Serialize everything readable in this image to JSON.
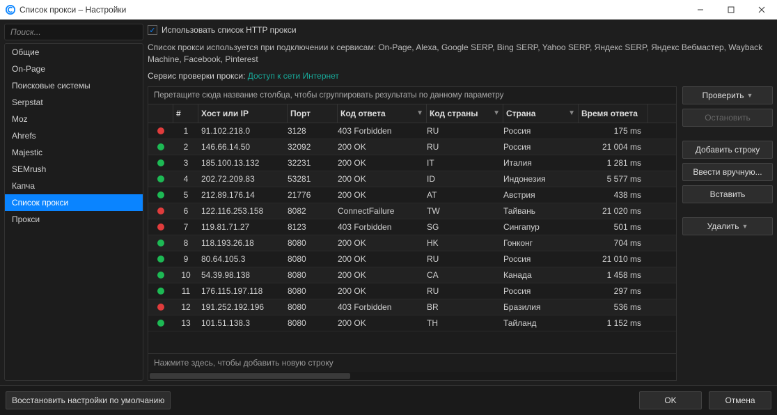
{
  "window": {
    "title": "Список прокси – Настройки"
  },
  "sidebar": {
    "search_placeholder": "Поиск...",
    "items": [
      {
        "label": "Общие",
        "active": false
      },
      {
        "label": "On-Page",
        "active": false
      },
      {
        "label": "Поисковые системы",
        "active": false
      },
      {
        "label": "Serpstat",
        "active": false
      },
      {
        "label": "Moz",
        "active": false
      },
      {
        "label": "Ahrefs",
        "active": false
      },
      {
        "label": "Majestic",
        "active": false
      },
      {
        "label": "SEMrush",
        "active": false
      },
      {
        "label": "Капча",
        "active": false
      },
      {
        "label": "Список прокси",
        "active": true
      },
      {
        "label": "Прокси",
        "active": false
      }
    ]
  },
  "main": {
    "use_http_proxy_label": "Использовать список HTTP прокси",
    "description": "Список прокси используется при подключении к сервисам: On-Page, Alexa, Google SERP, Bing SERP, Yahoo SERP, Яндекс SERP, Яндекс Вебмастер, Wayback Machine, Facebook, Pinterest",
    "service_label": "Сервис проверки прокси: ",
    "service_link": "Доступ к сети Интернет",
    "group_hint": "Перетащите сюда название столбца, чтобы сгруппировать результаты по данному параметру",
    "new_row_hint": "Нажмите здесь, чтобы добавить новую строку",
    "columns": {
      "num": "#",
      "host": "Хост или IP",
      "port": "Порт",
      "code": "Код ответа",
      "cc": "Код страны",
      "country": "Страна",
      "time": "Время ответа"
    },
    "rows": [
      {
        "n": 1,
        "status": "red",
        "host": "91.102.218.0",
        "port": "3128",
        "code": "403 Forbidden",
        "cc": "RU",
        "country": "Россия",
        "time": "175 ms"
      },
      {
        "n": 2,
        "status": "green",
        "host": "146.66.14.50",
        "port": "32092",
        "code": "200 OK",
        "cc": "RU",
        "country": "Россия",
        "time": "21 004 ms"
      },
      {
        "n": 3,
        "status": "green",
        "host": "185.100.13.132",
        "port": "32231",
        "code": "200 OK",
        "cc": "IT",
        "country": "Италия",
        "time": "1 281 ms"
      },
      {
        "n": 4,
        "status": "green",
        "host": "202.72.209.83",
        "port": "53281",
        "code": "200 OK",
        "cc": "ID",
        "country": "Индонезия",
        "time": "5 577 ms"
      },
      {
        "n": 5,
        "status": "green",
        "host": "212.89.176.14",
        "port": "21776",
        "code": "200 OK",
        "cc": "AT",
        "country": "Австрия",
        "time": "438 ms"
      },
      {
        "n": 6,
        "status": "red",
        "host": "122.116.253.158",
        "port": "8082",
        "code": "ConnectFailure",
        "cc": "TW",
        "country": "Тайвань",
        "time": "21 020 ms"
      },
      {
        "n": 7,
        "status": "red",
        "host": "119.81.71.27",
        "port": "8123",
        "code": "403 Forbidden",
        "cc": "SG",
        "country": "Сингапур",
        "time": "501 ms"
      },
      {
        "n": 8,
        "status": "green",
        "host": "118.193.26.18",
        "port": "8080",
        "code": "200 OK",
        "cc": "HK",
        "country": "Гонконг",
        "time": "704 ms"
      },
      {
        "n": 9,
        "status": "green",
        "host": "80.64.105.3",
        "port": "8080",
        "code": "200 OK",
        "cc": "RU",
        "country": "Россия",
        "time": "21 010 ms"
      },
      {
        "n": 10,
        "status": "green",
        "host": "54.39.98.138",
        "port": "8080",
        "code": "200 OK",
        "cc": "CA",
        "country": "Канада",
        "time": "1 458 ms"
      },
      {
        "n": 11,
        "status": "green",
        "host": "176.115.197.118",
        "port": "8080",
        "code": "200 OK",
        "cc": "RU",
        "country": "Россия",
        "time": "297 ms"
      },
      {
        "n": 12,
        "status": "red",
        "host": "191.252.192.196",
        "port": "8080",
        "code": "403 Forbidden",
        "cc": "BR",
        "country": "Бразилия",
        "time": "536 ms"
      },
      {
        "n": 13,
        "status": "green",
        "host": "101.51.138.3",
        "port": "8080",
        "code": "200 OK",
        "cc": "TH",
        "country": "Тайланд",
        "time": "1 152 ms"
      }
    ]
  },
  "buttons": {
    "check": "Проверить",
    "stop": "Остановить",
    "add_row": "Добавить строку",
    "manual": "Ввести вручную...",
    "paste": "Вставить",
    "delete": "Удалить",
    "restore": "Восстановить настройки по умолчанию",
    "ok": "OK",
    "cancel": "Отмена"
  }
}
